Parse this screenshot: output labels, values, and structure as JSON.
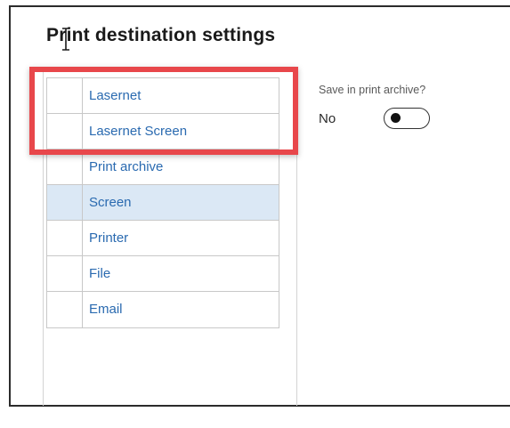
{
  "page": {
    "title": "Print destination settings"
  },
  "destinations": [
    {
      "label": "Lasernet",
      "selected": false
    },
    {
      "label": "Lasernet Screen",
      "selected": false
    },
    {
      "label": "Print archive",
      "selected": false
    },
    {
      "label": "Screen",
      "selected": true
    },
    {
      "label": "Printer",
      "selected": false
    },
    {
      "label": "File",
      "selected": false
    },
    {
      "label": "Email",
      "selected": false
    }
  ],
  "archive": {
    "label": "Save in print archive?",
    "value": "No",
    "enabled": false
  },
  "colors": {
    "link": "#2a6ab0",
    "selected_row": "#dbe8f5",
    "highlight": "#e8474b"
  },
  "icons": {
    "cursor": "text-cursor-icon"
  }
}
